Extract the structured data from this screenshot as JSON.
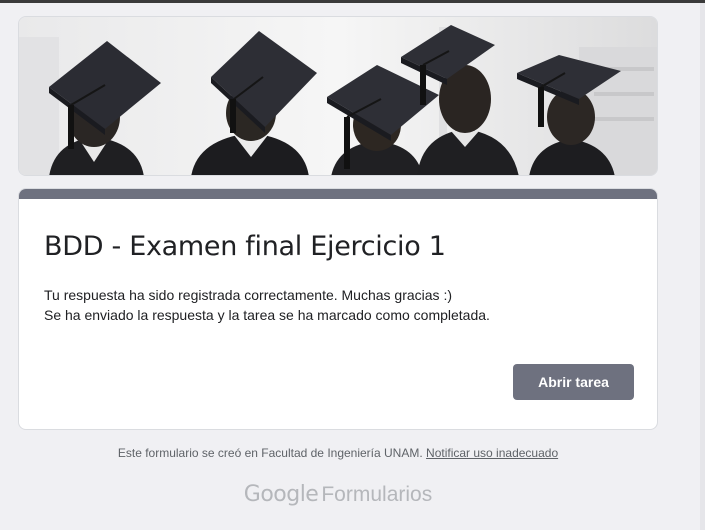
{
  "form": {
    "title": "BDD - Examen final Ejercicio 1",
    "confirmation_line1": "Tu respuesta ha sido registrada correctamente. Muchas gracias :)",
    "confirmation_line2": "Se ha enviado la respuesta y la tarea se ha marcado como completada.",
    "open_task_label": "Abrir tarea",
    "header_image_icon": "graduation-caps-photo"
  },
  "footer": {
    "created_in_text": "Este formulario se creó en Facultad de Ingeniería UNAM.",
    "report_link": "Notificar uso inadecuado",
    "brand_google": "Google",
    "brand_product": "Formularios"
  },
  "colors": {
    "accent": "#6e717f",
    "background": "#f0f0f3"
  }
}
